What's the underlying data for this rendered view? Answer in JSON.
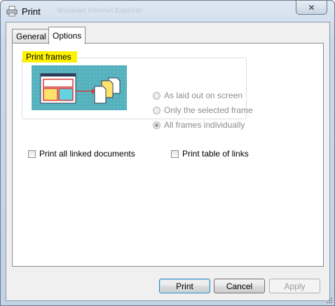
{
  "window": {
    "title": "Print",
    "background_title": "Windows Internet Explorer",
    "close_symbol": "✕",
    "icon": "printer-icon"
  },
  "tabs": [
    {
      "label": "General",
      "active": false
    },
    {
      "label": "Options",
      "active": true
    }
  ],
  "print_frames": {
    "label": "Print frames",
    "options": [
      {
        "label": "As laid out on screen",
        "selected": false,
        "enabled": false
      },
      {
        "label": "Only the selected frame",
        "selected": false,
        "enabled": false
      },
      {
        "label": "All frames individually",
        "selected": true,
        "enabled": false
      }
    ]
  },
  "checkboxes": {
    "linked_documents": {
      "label": "Print all linked documents",
      "checked": false
    },
    "table_of_links": {
      "label": "Print table of links",
      "checked": false
    }
  },
  "buttons": {
    "print": "Print",
    "cancel": "Cancel",
    "apply": "Apply"
  },
  "colors": {
    "highlight": "#fff200",
    "illustration_bg": "#59b7c2",
    "frame_red": "#d63a3a"
  }
}
